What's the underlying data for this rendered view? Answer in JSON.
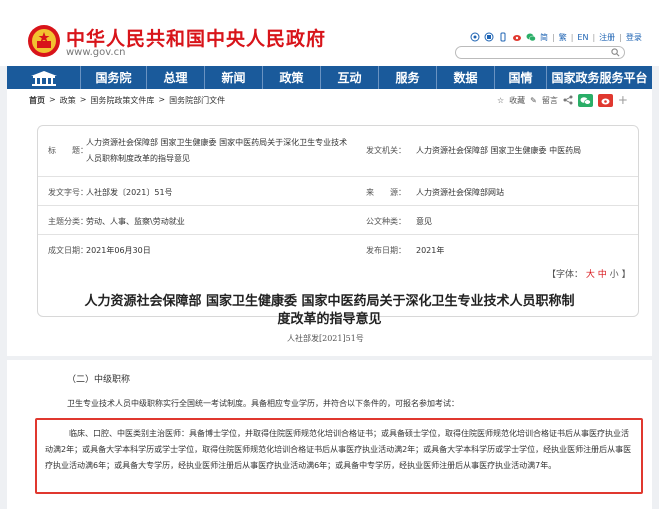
{
  "header": {
    "site_title": "中华人民共和国中央人民政府",
    "site_url": "www.gov.cn",
    "tools": {
      "lang_traditional": "简",
      "lang_simplified": "繁",
      "lang_en": "EN",
      "register": "注册",
      "login": "登录",
      "sep": "|"
    }
  },
  "nav": {
    "items": [
      "国务院",
      "总理",
      "新闻",
      "政策",
      "互动",
      "服务",
      "数据",
      "国情",
      "国家政务服务平台"
    ]
  },
  "breadcrumb": {
    "items": [
      "首页",
      ">",
      "政策",
      ">",
      "国务院政策文件库",
      ">",
      "国务院部门文件"
    ]
  },
  "share": {
    "favorite": "收藏",
    "comment": "留言"
  },
  "meta": {
    "title_label": "标　　题：",
    "title_value_line1": "人力资源社会保障部 国家卫生健康委 国家中医药局关于深化卫生专业技术",
    "title_value_line2": "人员职称制度改革的指导意见",
    "issuer_label": "发文机关：",
    "issuer_value": "人力资源社会保障部 国家卫生健康委 中医药局",
    "doc_no_label": "发文字号：",
    "doc_no_value": "人社部发〔2021〕51号",
    "source_label": "来　　源：",
    "source_value": "人力资源社会保障部网站",
    "category_label": "主题分类：",
    "category_value": "劳动、人事、监察\\劳动就业",
    "type_label": "公文种类：",
    "type_value": "意见",
    "written_label": "成文日期：",
    "written_value": "2021年06月30日",
    "publish_label": "发布日期：",
    "publish_value": "2021年"
  },
  "font_size": {
    "prefix": "【字体：",
    "large": "大",
    "medium": "中",
    "small": "小",
    "suffix": "】"
  },
  "document": {
    "title_line1": "人力资源社会保障部 国家卫生健康委 国家中医药局关于深化卫生专业技术人员职称制",
    "title_line2": "度改革的指导意见",
    "doc_no": "人社部发[2021]51号"
  },
  "body": {
    "section_heading": "（二）中级职称",
    "paragraph1": "卫生专业技术人员中级职称实行全国统一考试制度。具备相应专业学历，并符合以下条件的，可报名参加考试：",
    "highlight": "临床、口腔、中医类别主治医师：具备博士学位，并取得住院医师规范化培训合格证书；或具备硕士学位，取得住院医师规范化培训合格证书后从事医疗执业活动满2年；或具备大学本科学历或学士学位，取得住院医师规范化培训合格证书后从事医疗执业活动满2年；或具备大学本科学历或学士学位，经执业医师注册后从事医疗执业活动满6年；或具备大专学历，经执业医师注册后从事医疗执业活动满6年；或具备中专学历，经执业医师注册后从事医疗执业活动满7年。"
  },
  "colors": {
    "brand_red": "#d8141a",
    "nav_blue": "#1a5a9b",
    "highlight_border": "#e0382f"
  }
}
